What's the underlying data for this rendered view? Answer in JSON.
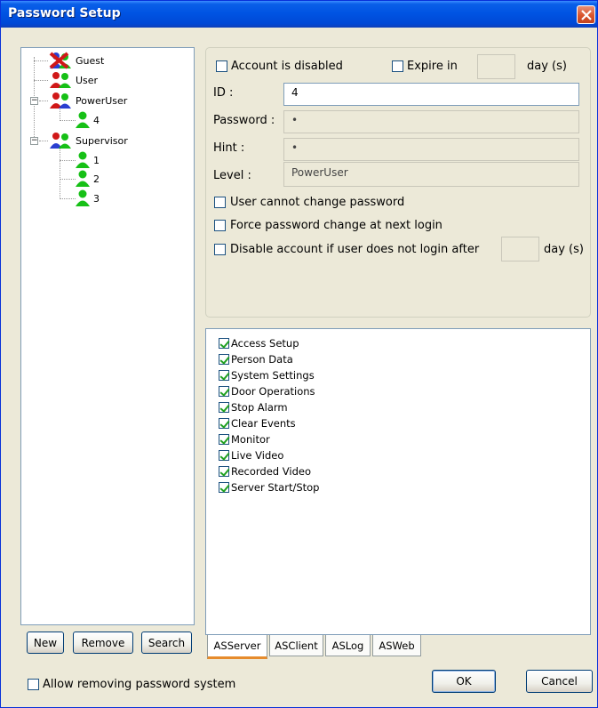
{
  "window": {
    "title": "Password Setup"
  },
  "tree": {
    "items": [
      {
        "label": "Guest"
      },
      {
        "label": "User"
      },
      {
        "label": "PowerUser"
      },
      {
        "label": "4"
      },
      {
        "label": "Supervisor"
      },
      {
        "label": "1"
      },
      {
        "label": "2"
      },
      {
        "label": "3"
      }
    ]
  },
  "tree_buttons": {
    "new": "New",
    "remove": "Remove",
    "search": "Search"
  },
  "account": {
    "disabled_label": "Account is disabled",
    "disabled_checked": false,
    "expire_label": "Expire in",
    "expire_checked": false,
    "expire_value": "",
    "expire_unit": "day (s)",
    "id_label": "ID :",
    "id_value": "4",
    "password_label": "Password :",
    "password_value": "•",
    "hint_label": "Hint :",
    "hint_value": "•",
    "level_label": "Level :",
    "level_value": "PowerUser",
    "cannot_change_label": "User cannot change password",
    "force_change_label": "Force password change at next login",
    "disable_inactive_label": "Disable account if user does not login after",
    "disable_inactive_value": "",
    "disable_inactive_unit": "day (s)"
  },
  "permissions": [
    {
      "label": "Access Setup",
      "checked": true
    },
    {
      "label": "Person Data",
      "checked": true
    },
    {
      "label": "System Settings",
      "checked": true
    },
    {
      "label": "Door Operations",
      "checked": true
    },
    {
      "label": "Stop Alarm",
      "checked": true
    },
    {
      "label": "Clear Events",
      "checked": true
    },
    {
      "label": "Monitor",
      "checked": true
    },
    {
      "label": "Live Video",
      "checked": true
    },
    {
      "label": "Recorded Video",
      "checked": true
    },
    {
      "label": "Server Start/Stop",
      "checked": true
    }
  ],
  "tabs": [
    {
      "label": "ASServer",
      "active": true
    },
    {
      "label": "ASClient",
      "active": false
    },
    {
      "label": "ASLog",
      "active": false
    },
    {
      "label": "ASWeb",
      "active": false
    }
  ],
  "footer": {
    "allow_removing_label": "Allow removing password system",
    "ok": "OK",
    "cancel": "Cancel"
  },
  "colors": {
    "titlebar": "#0054e3",
    "window_bg": "#ece9d8",
    "user_icon": "#16c016",
    "role_icon": "#2a3fd0",
    "disabled_x": "#d01818"
  }
}
